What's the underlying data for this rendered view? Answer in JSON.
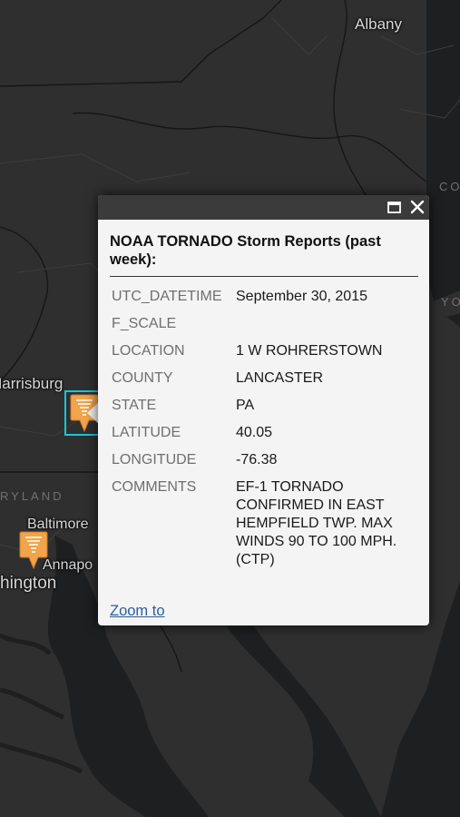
{
  "map": {
    "labels": {
      "albany": "Albany",
      "harrisburg": "Harrisburg",
      "maryland": "RYLAND",
      "baltimore": "Baltimore",
      "annapolis": "Annapo",
      "washington": "hington",
      "connecticut": "CO",
      "newyork": "YO"
    },
    "marker_icon": "tornado-marker-icon",
    "selection_color": "#19c6d6"
  },
  "popup": {
    "title": "NOAA TORNADO Storm Reports (past week):",
    "maximize_icon": "maximize-icon",
    "close_icon": "close-icon",
    "fields": [
      {
        "key": "UTC_DATETIME",
        "value": "September 30, 2015"
      },
      {
        "key": "F_SCALE",
        "value": ""
      },
      {
        "key": "LOCATION",
        "value": "1 W ROHRERSTOWN"
      },
      {
        "key": "COUNTY",
        "value": "LANCASTER"
      },
      {
        "key": "STATE",
        "value": "PA"
      },
      {
        "key": "LATITUDE",
        "value": "40.05"
      },
      {
        "key": "LONGITUDE",
        "value": "-76.38"
      },
      {
        "key": "COMMENTS",
        "value": "EF-1 TORNADO CONFIRMED IN EAST HEMPFIELD TWP. MAX WINDS 90 TO 100 MPH. (CTP)"
      }
    ],
    "zoom_label": "Zoom to"
  }
}
